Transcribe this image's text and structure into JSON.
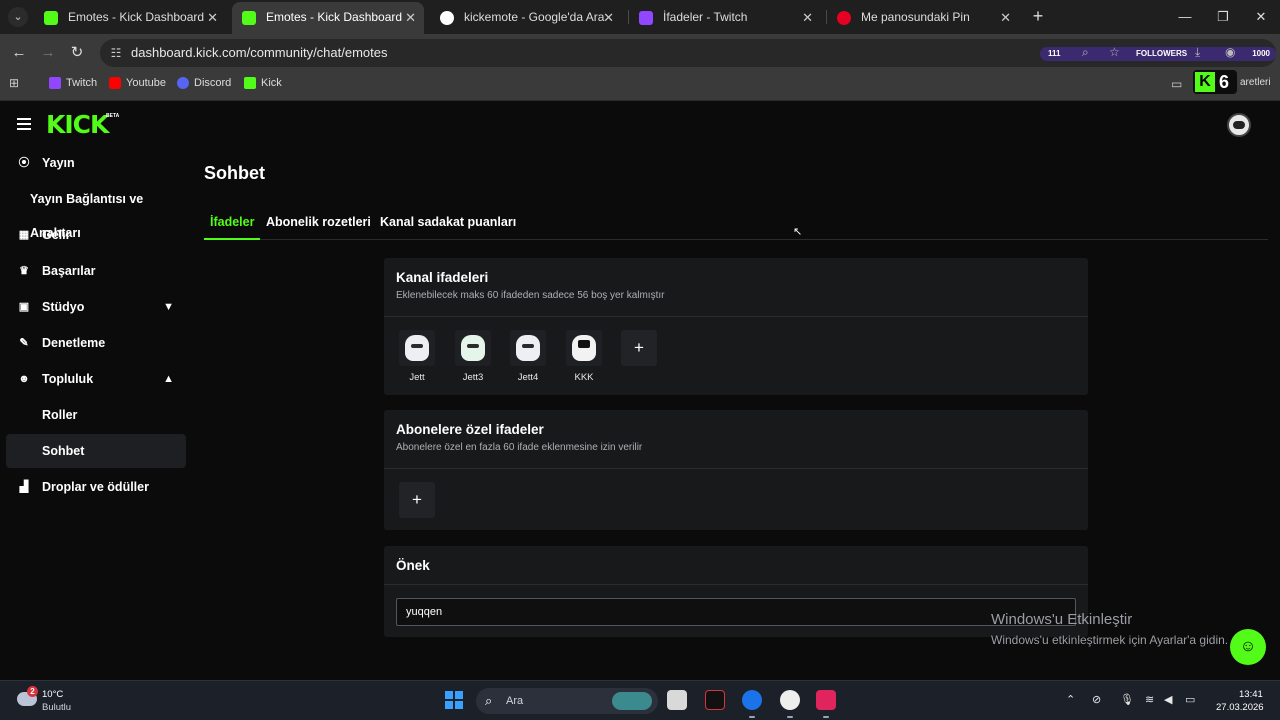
{
  "browser": {
    "tabs": [
      {
        "label": "Emotes - Kick Dashboard",
        "favicon": "kick-icon",
        "color": "#53fc18"
      },
      {
        "label": "Emotes - Kick Dashboard",
        "favicon": "kick-icon",
        "color": "#53fc18"
      },
      {
        "label": "kickemote - Google'da Ara",
        "favicon": "google-icon",
        "color": "#4285f4"
      },
      {
        "label": "İfadeler - Twitch",
        "favicon": "twitch-icon",
        "color": "#9146ff"
      },
      {
        "label": "Me panosundaki Pin",
        "favicon": "pinterest-icon",
        "color": "#e60023"
      }
    ],
    "url": "dashboard.kick.com/community/chat/emotes",
    "overlay": {
      "left": "111",
      "middle": "FOLLOWERS",
      "right": "1000"
    },
    "bookmarks": [
      {
        "label": "Twitch",
        "color": "#9146ff"
      },
      {
        "label": "Youtube",
        "color": "#ff0000"
      },
      {
        "label": "Discord",
        "color": "#5865f2"
      },
      {
        "label": "Kick",
        "color": "#53fc18"
      }
    ],
    "bookmark_more": "aretleri",
    "kick_badge_number": "6"
  },
  "app": {
    "logo": "KICK",
    "logo_tag": "BETA",
    "accent_color": "#53fc18",
    "sidebar": {
      "items": [
        {
          "label": "Yayın",
          "icon": "broadcast-icon"
        },
        {
          "label": "Yayın Bağlantısı ve Anahtarı",
          "icon": ""
        },
        {
          "label": "Gelir",
          "icon": "revenue-icon"
        },
        {
          "label": "Başarılar",
          "icon": "trophy-icon"
        },
        {
          "label": "Stüdyo",
          "icon": "studio-icon"
        },
        {
          "label": "Denetleme",
          "icon": "wrench-icon"
        },
        {
          "label": "Topluluk",
          "icon": "community-icon"
        },
        {
          "label": "Roller",
          "icon": ""
        },
        {
          "label": "Sohbet",
          "icon": ""
        },
        {
          "label": "Droplar ve ödüller",
          "icon": "drops-icon"
        }
      ]
    },
    "page_title": "Sohbet",
    "tabs": [
      {
        "label": "İfadeler"
      },
      {
        "label": "Abonelik rozetleri"
      },
      {
        "label": "Kanal sadakat puanları"
      }
    ],
    "channel_emotes": {
      "title": "Kanal ifadeleri",
      "subtitle": "Eklenebilecek maks 60 ifadeden sadece 56 boş yer kalmıştır",
      "emotes": [
        {
          "name": "Jett"
        },
        {
          "name": "Jett3"
        },
        {
          "name": "Jett4"
        },
        {
          "name": "KKK"
        }
      ],
      "add_label": "+"
    },
    "subscriber_emotes": {
      "title": "Abonelere özel ifadeler",
      "subtitle": "Abonelere özel en fazla 60 ifade eklenmesine izin verilir",
      "add_label": "+"
    },
    "prefix": {
      "title": "Önek",
      "value": "yuqqen"
    }
  },
  "watermark": {
    "line1": "Windows'u Etkinleştir",
    "line2": "Windows'u etkinleştirmek için Ayarlar'a gidin."
  },
  "taskbar": {
    "weather_badge": "2",
    "temperature": "10°C",
    "condition": "Bulutlu",
    "search_placeholder": "Ara",
    "time": "13:41",
    "date": "27.03.2026"
  }
}
